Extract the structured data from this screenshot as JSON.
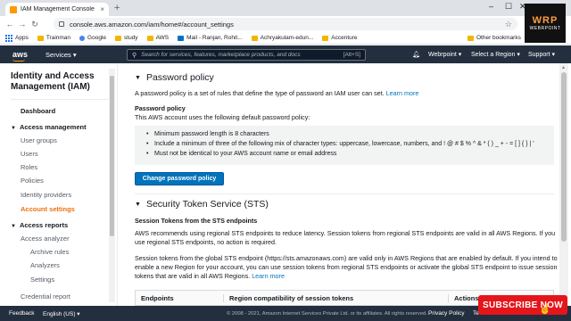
{
  "browser": {
    "tab_title": "IAM Management Console",
    "tab_close": "×",
    "new_tab": "+",
    "url": "console.aws.amazon.com/iam/home#/account_settings",
    "win_min": "–",
    "win_max": "☐",
    "win_close": "✕",
    "bookmarks": [
      {
        "label": "Apps",
        "icon": "apps-icon"
      },
      {
        "label": "Trainman",
        "icon": "folder-icon"
      },
      {
        "label": "Google",
        "icon": "google-icon"
      },
      {
        "label": "study",
        "icon": "folder-icon"
      },
      {
        "label": "AWS",
        "icon": "folder-icon"
      },
      {
        "label": "Mail - Ranjan, Rohit...",
        "icon": "mail-icon"
      },
      {
        "label": "Achryakulam-edun...",
        "icon": "folder-icon"
      },
      {
        "label": "Accenture",
        "icon": "folder-icon"
      }
    ],
    "other_bookmarks": "Other bookmarks"
  },
  "watermark": {
    "big": "WRP",
    "small": "WEBRPOINT"
  },
  "aws_nav": {
    "logo": "aws",
    "services": "Services ▾",
    "search_placeholder": "Search for services, features, marketplace products, and docs",
    "search_shortcut": "[Alt+S]",
    "account": "Webrpoint ▾",
    "region": "Select a Region ▾",
    "support": "Support ▾"
  },
  "sidebar": {
    "title": "Identity and Access Management (IAM)",
    "dashboard": "Dashboard",
    "access_management": "Access management",
    "items": [
      "User groups",
      "Users",
      "Roles",
      "Policies",
      "Identity providers",
      "Account settings"
    ],
    "access_reports": "Access reports",
    "access_analyzer": "Access analyzer",
    "analyzer_items": [
      "Archive rules",
      "Analyzers",
      "Settings"
    ],
    "credential_report": "Credential report"
  },
  "password_policy": {
    "heading": "Password policy",
    "intro": "A password policy is a set of rules that define the type of password an IAM user can set.",
    "learn_more": "Learn more",
    "subheading": "Password policy",
    "default_text": "This AWS account uses the following default password policy:",
    "rules": [
      "Minimum password length is 8 characters",
      "Include a minimum of three of the following mix of character types: uppercase, lowercase, numbers, and ! @ # $ % ^ & * ( ) _ + - = [ ] { } | '",
      "Must not be identical to your AWS account name or email address"
    ],
    "button": "Change password policy"
  },
  "sts": {
    "heading": "Security Token Service (STS)",
    "subheading": "Session Tokens from the STS endpoints",
    "para1_line1": "AWS recommends using regional STS endpoints to reduce latency. Session tokens from regional STS endpoints are valid in all AWS Regions. If you",
    "para1_line2": "use regional STS endpoints, no action is required.",
    "para2_line1": "Session tokens from the global STS endpoint (https://sts.amazonaws.com) are valid only in AWS Regions that are enabled by default. If you intend to",
    "para2_line2": "enable a new Region for your account, you can use session tokens from regional STS endpoints or activate the global STS endpoint to issue session",
    "para2_line3": "tokens that are valid in all AWS Regions.",
    "learn_more": "Learn more",
    "table_headers": [
      "Endpoints",
      "Region compatibility of session tokens",
      "Actions"
    ]
  },
  "footer": {
    "feedback": "Feedback",
    "language": "English (US) ▾",
    "copyright": "© 2008 - 2021, Amazon Internet Services Private Ltd. or its affiliates. All rights reserved.",
    "privacy": "Privacy Policy",
    "terms": "Te"
  },
  "overlay": {
    "subscribe": "SUBSCRIBE NOW"
  }
}
